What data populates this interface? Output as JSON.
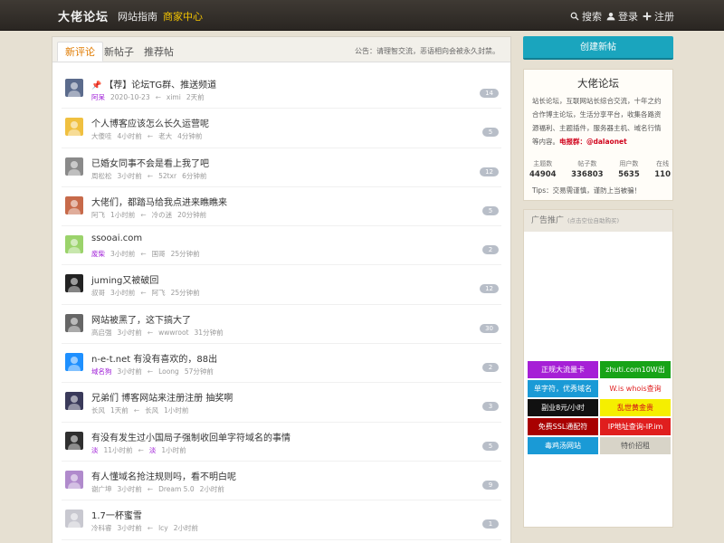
{
  "nav": {
    "logo": "大佬论坛",
    "links": [
      "网站指南",
      "商家中心"
    ],
    "search": "搜索",
    "login": "登录",
    "register": "注册"
  },
  "tabs": [
    "新评论",
    "新帖子",
    "推荐帖"
  ],
  "notice": "公告：请理智交流，恶语相向会被永久封禁。",
  "topics": [
    {
      "pinned": "📌",
      "title": "【荐】论坛TG群、推送频道",
      "user": "阿呆",
      "time": "2020-10-23",
      "reply_user": "ximi",
      "reply_time": "2天前",
      "count": "14"
    },
    {
      "pinned": "",
      "title": "个人博客应该怎么长久运营呢",
      "user": "大傻哇",
      "time": "4小时前",
      "reply_user": "老大",
      "reply_time": "4分钟前",
      "count": "5"
    },
    {
      "pinned": "",
      "title": "已婚女同事不会是看上我了吧",
      "user": "周松松",
      "time": "3小时前",
      "reply_user": "52txr",
      "reply_time": "6分钟前",
      "count": "12"
    },
    {
      "pinned": "",
      "title": "大佬们，都踏马给我点进来瞧瞧来",
      "user": "阿飞",
      "time": "1小时前",
      "reply_user": "冷の迷",
      "reply_time": "20分钟前",
      "count": "5"
    },
    {
      "pinned": "",
      "title": "ssooai.com",
      "user": "废柴",
      "time": "3小时前",
      "reply_user": "国哥",
      "reply_time": "25分钟前",
      "count": "2"
    },
    {
      "pinned": "",
      "title": "juming又被破回",
      "user": "叔哥",
      "time": "3小时前",
      "reply_user": "阿飞",
      "reply_time": "25分钟前",
      "count": "12"
    },
    {
      "pinned": "",
      "title": "网站被黑了，这下搞大了",
      "user": "高启强",
      "time": "3小时前",
      "reply_user": "wwwroot",
      "reply_time": "31分钟前",
      "count": "30"
    },
    {
      "pinned": "",
      "title": "n-e-t.net 有没有喜欢的，88出",
      "user": "域名狗",
      "time": "3小时前",
      "reply_user": "Loong",
      "reply_time": "57分钟前",
      "count": "2"
    },
    {
      "pinned": "",
      "title": "兄弟们 博客网站来注册注册 抽奖啊",
      "user": "长风",
      "time": "1天前",
      "reply_user": "长风",
      "reply_time": "1小时前",
      "count": "3"
    },
    {
      "pinned": "",
      "title": "有没有发生过小国局子强制收回单字符域名的事情",
      "user": "淡",
      "time": "11小时前",
      "reply_user": "淡",
      "reply_time": "1小时前",
      "count": "5"
    },
    {
      "pinned": "",
      "title": "有人懂域名抢注规则吗，看不明白呢",
      "user": "谢广坤",
      "time": "3小时前",
      "reply_user": "Dream 5.0",
      "reply_time": "2小时前",
      "count": "9"
    },
    {
      "pinned": "",
      "title": "1.7一杯蜜雪",
      "user": "冷科睿",
      "time": "3小时前",
      "reply_user": "lcy",
      "reply_time": "2小时前",
      "count": "1"
    }
  ],
  "sidebar": {
    "create_button": "创建新帖",
    "forum_title": "大佬论坛",
    "desc": "站长论坛，互联网站长综合交流，十年之约合作博主论坛，生活分享平台，收集各路资源福利、主题插件，服务器主机、域名行情等内容。",
    "desc_label": "电报群：",
    "desc_link": "@dalaonet",
    "stats": [
      {
        "label": "主题数",
        "value": "44904"
      },
      {
        "label": "帖子数",
        "value": "336803"
      },
      {
        "label": "用户数",
        "value": "5635"
      },
      {
        "label": "在线",
        "value": "110"
      }
    ],
    "tips": "Tips：交易需谨慎，谨防上当被骗！",
    "ad_title": "广告推广",
    "ad_sub": "(点击空位自助购买)",
    "ads": [
      {
        "text": "正规大流量卡",
        "bg": "#a61fd6",
        "fg": "#ffffff"
      },
      {
        "text": "zhuti.com10W出",
        "bg": "#17a317",
        "fg": "#ffffff"
      },
      {
        "text": "单字符，优秀域名",
        "bg": "#1a9ad6",
        "fg": "#ffffff"
      },
      {
        "text": "W.is whois查询",
        "bg": "#ffffff",
        "fg": "#e02020"
      },
      {
        "text": "副业8元/小时",
        "bg": "#111111",
        "fg": "#ffffff"
      },
      {
        "text": "乱世黄金贵",
        "bg": "#f5ef00",
        "fg": "#d0021b"
      },
      {
        "text": "免费SSL通配符",
        "bg": "#a80000",
        "fg": "#ffffff"
      },
      {
        "text": "IP地址查询-IP.im",
        "bg": "#e01e1e",
        "fg": "#ffffff"
      },
      {
        "text": "毒鸡汤网站",
        "bg": "#1a9ad6",
        "fg": "#ffffff"
      },
      {
        "text": "特价招租",
        "bg": "#d8d4c8",
        "fg": "#555555"
      }
    ]
  }
}
